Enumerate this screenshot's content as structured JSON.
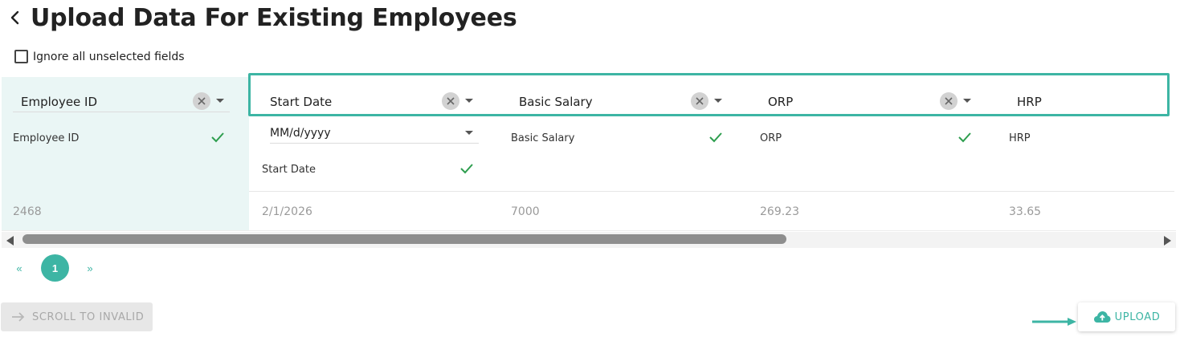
{
  "header": {
    "title": "Upload Data For Existing Employees",
    "back_icon": "chevron-left-icon"
  },
  "options": {
    "ignore_unselected_label": "Ignore all unselected fields",
    "ignore_unselected_checked": false
  },
  "columns": [
    {
      "mapped_field": "Employee ID",
      "file_header": "Employee ID",
      "valid": true,
      "row_value": "2468"
    },
    {
      "mapped_field": "Start Date",
      "date_format": "MM/d/yyyy",
      "file_header": "Start Date",
      "valid": true,
      "row_value": "2/1/2026"
    },
    {
      "mapped_field": "Basic Salary",
      "file_header": "Basic Salary",
      "valid": true,
      "row_value": "7000"
    },
    {
      "mapped_field": "ORP",
      "file_header": "ORP",
      "valid": true,
      "row_value": "269.23"
    },
    {
      "mapped_field": "HRP",
      "file_header": "HRP",
      "valid": null,
      "row_value": "33.65"
    }
  ],
  "pagination": {
    "prev_label": "«",
    "current_page": "1",
    "next_label": "»"
  },
  "actions": {
    "scroll_to_invalid_label": "SCROLL TO INVALID",
    "upload_label": "UPLOAD"
  },
  "colors": {
    "accent": "#3db5a4",
    "check": "#2e9e4f",
    "first_column_bg": "#eaf6f5",
    "disabled_bg": "#e7e7e7"
  }
}
